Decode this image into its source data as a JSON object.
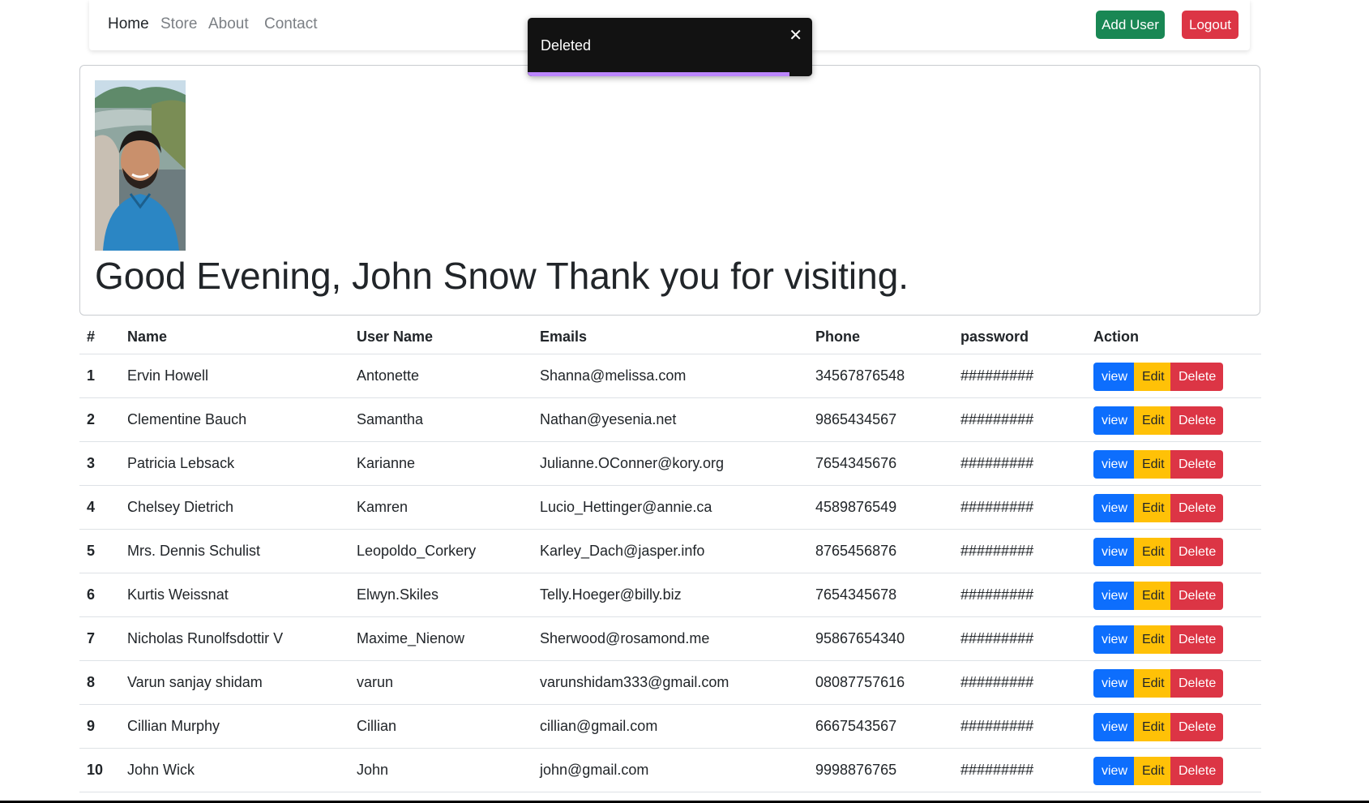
{
  "nav": {
    "links": [
      "Home",
      "Store",
      "About",
      "Contact"
    ],
    "add_user_label": "Add User",
    "logout_label": "Logout"
  },
  "toast": {
    "message": "Deleted",
    "close_icon": "close-icon",
    "progress_fraction": 0.92
  },
  "welcome": {
    "greeting": "Good Evening, John Snow Thank you for visiting."
  },
  "table": {
    "headers": [
      "#",
      "Name",
      "User Name",
      "Emails",
      "Phone",
      "password",
      "Action"
    ],
    "action_labels": {
      "view": "view",
      "edit": "Edit",
      "delete": "Delete"
    },
    "rows": [
      {
        "num": "1",
        "name": "Ervin Howell",
        "username": "Antonette",
        "email": "Shanna@melissa.com",
        "phone": "34567876548",
        "password": "#########"
      },
      {
        "num": "2",
        "name": "Clementine Bauch",
        "username": "Samantha",
        "email": "Nathan@yesenia.net",
        "phone": "9865434567",
        "password": "#########"
      },
      {
        "num": "3",
        "name": "Patricia Lebsack",
        "username": "Karianne",
        "email": "Julianne.OConner@kory.org",
        "phone": "7654345676",
        "password": "#########"
      },
      {
        "num": "4",
        "name": "Chelsey Dietrich",
        "username": "Kamren",
        "email": "Lucio_Hettinger@annie.ca",
        "phone": "4589876549",
        "password": "#########"
      },
      {
        "num": "5",
        "name": "Mrs. Dennis Schulist",
        "username": "Leopoldo_Corkery",
        "email": "Karley_Dach@jasper.info",
        "phone": "8765456876",
        "password": "#########"
      },
      {
        "num": "6",
        "name": "Kurtis Weissnat",
        "username": "Elwyn.Skiles",
        "email": "Telly.Hoeger@billy.biz",
        "phone": "7654345678",
        "password": "#########"
      },
      {
        "num": "7",
        "name": "Nicholas Runolfsdottir V",
        "username": "Maxime_Nienow",
        "email": "Sherwood@rosamond.me",
        "phone": "95867654340",
        "password": "#########"
      },
      {
        "num": "8",
        "name": "Varun sanjay shidam",
        "username": "varun",
        "email": "varunshidam333@gmail.com",
        "phone": "08087757616",
        "password": "#########"
      },
      {
        "num": "9",
        "name": "Cillian Murphy",
        "username": "Cillian",
        "email": "cillian@gmail.com",
        "phone": "6667543567",
        "password": "#########"
      },
      {
        "num": "10",
        "name": "John Wick",
        "username": "John",
        "email": "john@gmail.com",
        "phone": "9998876765",
        "password": "#########"
      }
    ]
  },
  "colors": {
    "primary": "#0d6efd",
    "success": "#198754",
    "danger": "#dc3545",
    "warning": "#ffc107",
    "toast_bg": "#121212",
    "toast_progress": "#bb86fc"
  }
}
